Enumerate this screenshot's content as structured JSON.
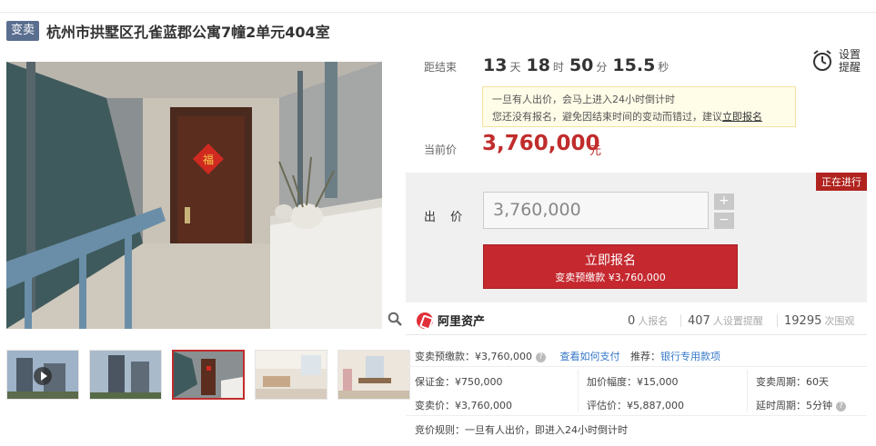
{
  "header": {
    "badge": "变卖",
    "title": "杭州市拱墅区孔雀蓝郡公寓7幢2单元404室"
  },
  "countdown": {
    "label": "距结束",
    "days": "13",
    "days_unit": "天",
    "hours": "18",
    "hours_unit": "时",
    "minutes": "50",
    "minutes_unit": "分",
    "seconds": "15.5",
    "seconds_unit": "秒"
  },
  "reminder": {
    "label": "设置提醒",
    "icon": "alarm-clock-icon"
  },
  "notice": {
    "line1": "一旦有人出价，会马上进入24小时倒计时",
    "line2_prefix": "您还没有报名，避免因结束时间的变动而错过，建议",
    "line2_link": "立即报名"
  },
  "current_price": {
    "label": "当前价",
    "value": "3,760,000",
    "unit": "元"
  },
  "bid": {
    "status_tag": "正在进行",
    "label": "出 价",
    "input_value": "3,760,000",
    "plus": "+",
    "minus": "−",
    "signup_label": "立即报名",
    "signup_sub": "变卖预缴款 ¥3,760,000"
  },
  "stats": {
    "brand": "阿里资产",
    "signups_count": "0",
    "signups_label": "人报名",
    "reminders_count": "407",
    "reminders_label": "人设置提醒",
    "views_count": "19295",
    "views_label": "次围观"
  },
  "details": {
    "deposit_label": "变卖预缴款：¥3,760,000",
    "how_to_pay": "查看如何支付",
    "recommend_prefix": "推荐：",
    "recommend_link": "银行专用款项",
    "guarantee": "保证金：¥750,000",
    "increment": "加价幅度：¥15,000",
    "period": "变卖周期：60天",
    "sale_price": "变卖价：¥3,760,000",
    "appraisal": "评估价：¥5,887,000",
    "extension": "延时周期：5分钟",
    "rule": "竞价规则：一旦有人出价，即进入24小时倒计时"
  },
  "colors": {
    "accent_red": "#c5282f",
    "badge_bg": "#5a6e8f",
    "link_blue": "#3377c8"
  }
}
